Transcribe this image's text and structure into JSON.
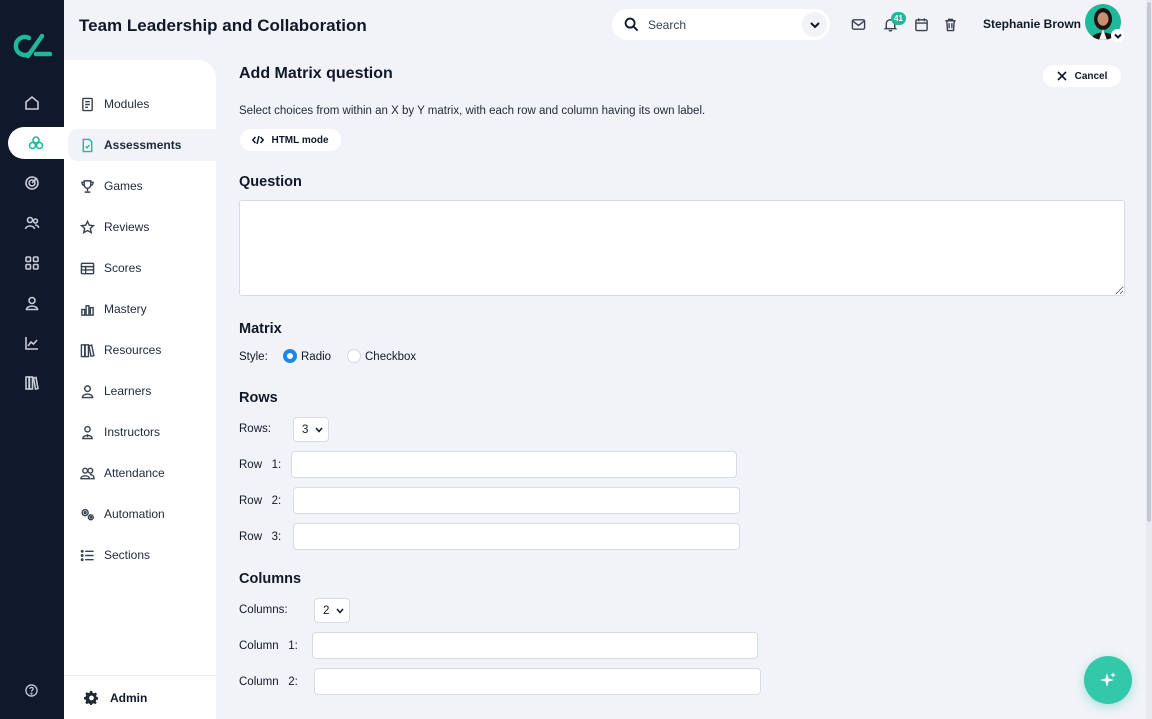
{
  "app": {
    "title": "Team Leadership and Collaboration"
  },
  "header": {
    "search_placeholder": "Search",
    "notification_count": "41",
    "user_name": "Stephanie Brown"
  },
  "rail": {
    "items": [
      "home",
      "assessments",
      "goals",
      "people",
      "apps",
      "profile",
      "analytics",
      "library"
    ],
    "active": "assessments"
  },
  "sidebar": {
    "items": [
      {
        "label": "Modules",
        "icon": "document-icon"
      },
      {
        "label": "Assessments",
        "icon": "assessment-icon"
      },
      {
        "label": "Games",
        "icon": "trophy-icon"
      },
      {
        "label": "Reviews",
        "icon": "star-icon"
      },
      {
        "label": "Scores",
        "icon": "table-icon"
      },
      {
        "label": "Mastery",
        "icon": "bar-chart-icon"
      },
      {
        "label": "Resources",
        "icon": "books-icon"
      },
      {
        "label": "Learners",
        "icon": "person-icon"
      },
      {
        "label": "Instructors",
        "icon": "instructor-icon"
      },
      {
        "label": "Attendance",
        "icon": "group-icon"
      },
      {
        "label": "Automation",
        "icon": "gears-icon"
      },
      {
        "label": "Sections",
        "icon": "list-icon"
      }
    ],
    "active": "Assessments",
    "admin_label": "Admin"
  },
  "form": {
    "title": "Add Matrix question",
    "cancel_label": "Cancel",
    "description": "Select choices from within an X by Y matrix, with each row and column having its own label.",
    "html_mode_label": "HTML mode",
    "question_heading": "Question",
    "question_value": "",
    "matrix_heading": "Matrix",
    "style_label": "Style:",
    "style_options": [
      "Radio",
      "Checkbox"
    ],
    "style_selected": "Radio",
    "rows_heading": "Rows",
    "rows_label": "Rows:",
    "rows_count": "3",
    "row_labels": [
      "Row   1:",
      "Row   2:",
      "Row   3:"
    ],
    "row_values": [
      "",
      "",
      ""
    ],
    "columns_heading": "Columns",
    "columns_label": "Columns:",
    "columns_count": "2",
    "column_labels": [
      "Column   1:",
      "Column   2:"
    ],
    "column_values": [
      "",
      ""
    ]
  },
  "colors": {
    "accent": "#1fb89a",
    "rail_bg": "#10182b",
    "page_bg": "#f1f3f8",
    "radio_selected": "#1e88e5"
  }
}
